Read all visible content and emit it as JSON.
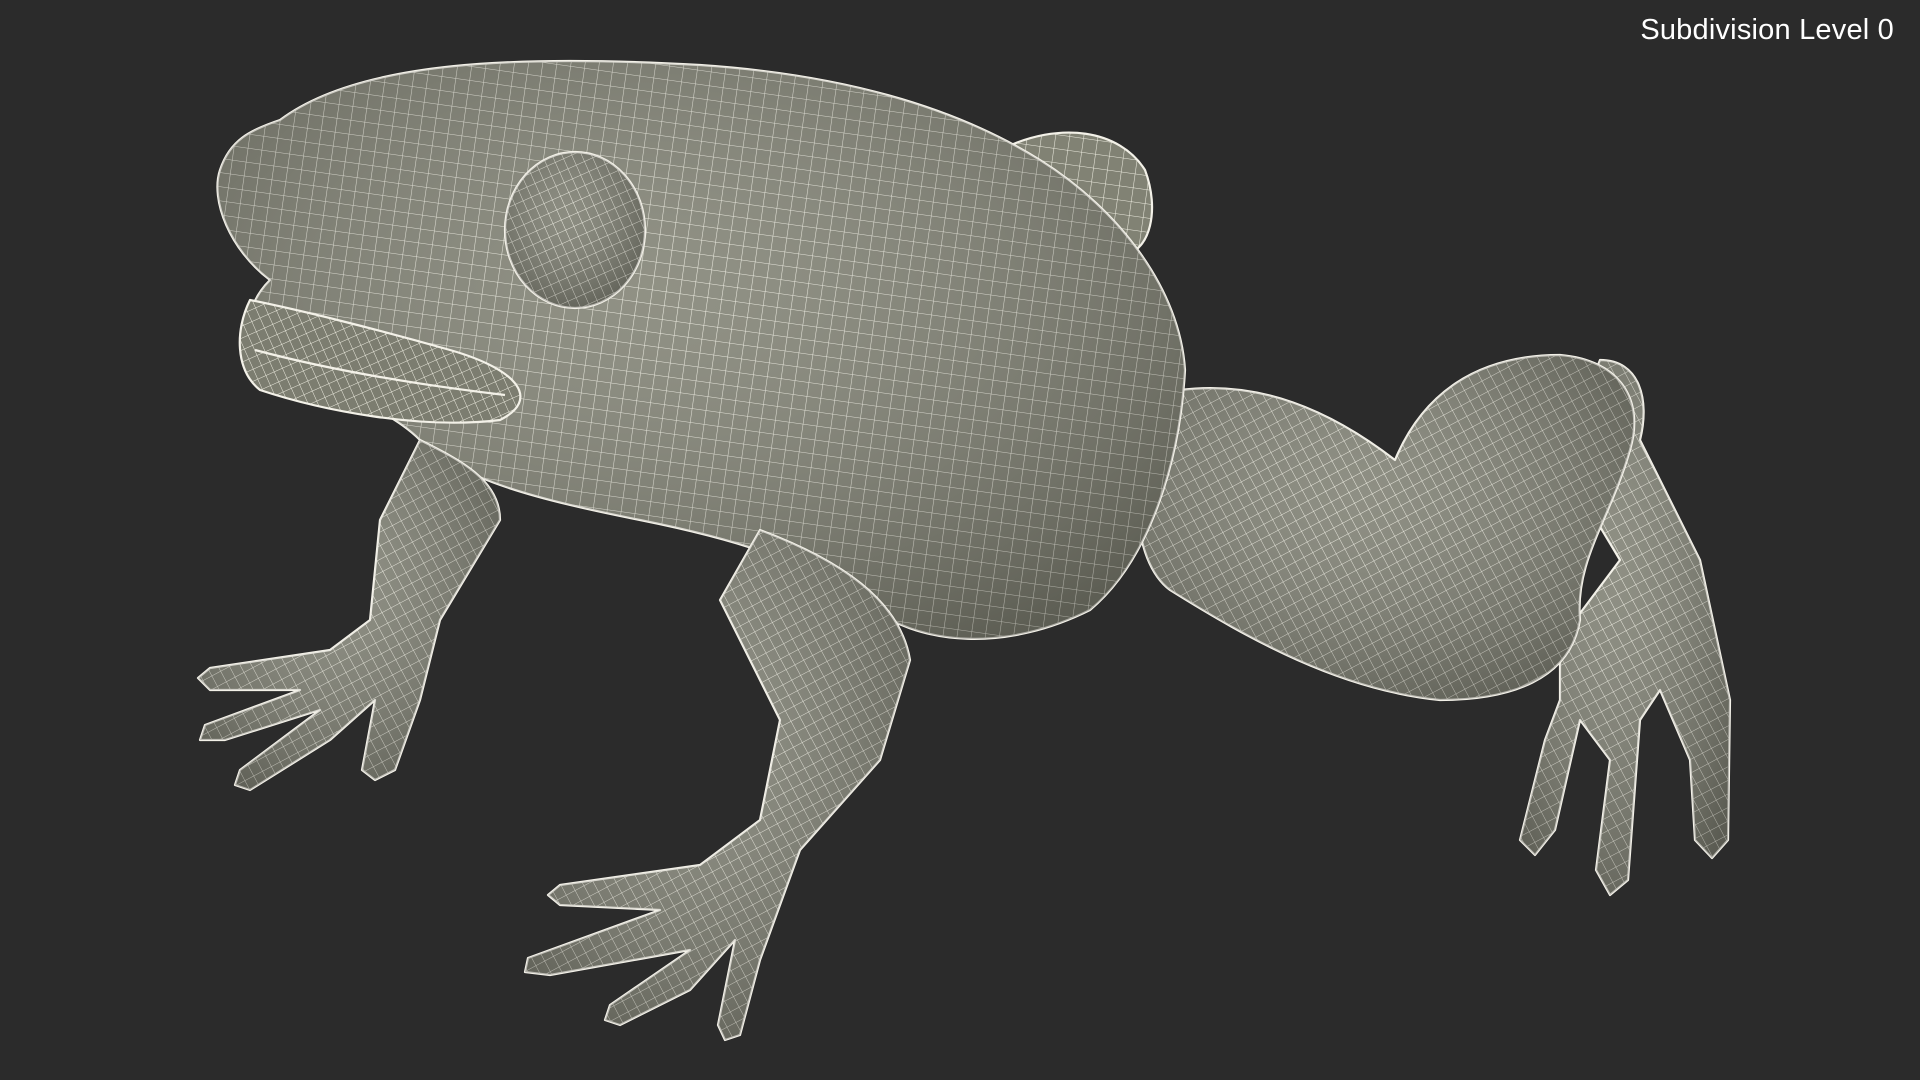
{
  "overlay": {
    "label": "Subdivision Level 0"
  },
  "scene": {
    "object": "frog-wireframe-mesh",
    "background_color": "#2b2b2b",
    "mesh_fill": "#818274",
    "wire_color": "#f3f1e8"
  }
}
